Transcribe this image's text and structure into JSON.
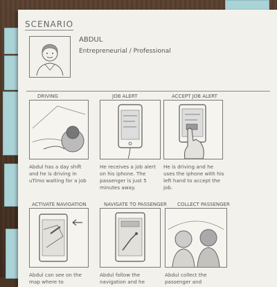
{
  "header": {
    "title": "SCENARIO"
  },
  "persona": {
    "name": "ABDUL",
    "role": "Entrepreneurial / Professional",
    "avatar_icon": "person-portrait-icon"
  },
  "panels": [
    {
      "label": "DRIVING",
      "caption": "Abdul has a day shift and he is driving in uTimo waiting for a job",
      "icon": "car-interior-icon"
    },
    {
      "label": "JOB ALERT",
      "caption": "He receives a job alert on his iphone. The passenger is just 5 minutes away.",
      "icon": "phone-alert-icon"
    },
    {
      "label": "ACCEPT JOB ALERT",
      "caption": "He is driving and he uses the iphone with his left hand to accept the job.",
      "icon": "hand-phone-icon"
    },
    {
      "label": "ACTIVATE NAVIGATION",
      "caption": "Abdul can see on the map where to",
      "icon": "phone-map-icon"
    },
    {
      "label": "NAVIGATE TO PASSENGER",
      "caption": "Abdul follow the navigation and he",
      "icon": "phone-navigation-icon"
    },
    {
      "label": "COLLECT PASSENGER",
      "caption": "Abdul collect the passenger and",
      "icon": "passengers-icon"
    }
  ]
}
